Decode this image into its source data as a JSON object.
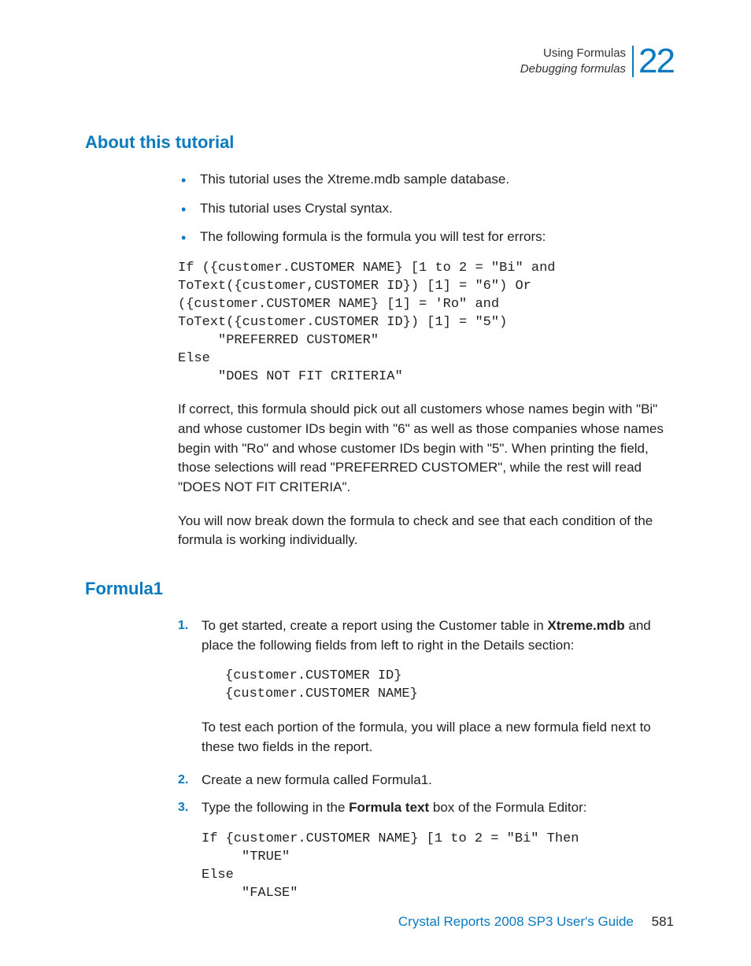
{
  "header": {
    "line1": "Using Formulas",
    "line2": "Debugging formulas",
    "chapter": "22"
  },
  "section1": {
    "title": "About this tutorial",
    "bullets": [
      "This tutorial uses the Xtreme.mdb sample database.",
      "This tutorial uses Crystal syntax.",
      "The following formula is the formula you will test for errors:"
    ],
    "code": "If ({customer.CUSTOMER NAME} [1 to 2 = \"Bi\" and\nToText({customer,CUSTOMER ID}) [1] = \"6\") Or\n({customer.CUSTOMER NAME} [1] = 'Ro\" and\nToText({customer.CUSTOMER ID}) [1] = \"5\")\n     \"PREFERRED CUSTOMER\"\nElse\n     \"DOES NOT FIT CRITERIA\"",
    "para1": "If correct, this formula should pick out all customers whose names begin with \"Bi\" and whose customer IDs begin with \"6\" as well as those companies whose names begin with \"Ro\" and whose customer IDs begin with \"5\". When printing the field, those selections will read \"PREFERRED CUSTOMER\", while the rest will read \"DOES NOT FIT CRITERIA\".",
    "para2": "You will now break down the formula to check and see that each condition of the formula is working individually."
  },
  "section2": {
    "title": "Formula1",
    "step1_pre": "To get started, create a report using the Customer table in ",
    "step1_bold": "Xtreme.mdb",
    "step1_post": " and place the following fields from left to right in the Details section:",
    "code1": "{customer.CUSTOMER ID}\n{customer.CUSTOMER NAME}",
    "para1": "To test each portion of the formula, you will place a new formula field next to these two fields in the report.",
    "step2": "Create a new formula called Formula1.",
    "step3_pre": "Type the following in the ",
    "step3_bold": "Formula text",
    "step3_post": " box of the Formula Editor:",
    "code2": "If {customer.CUSTOMER NAME} [1 to 2 = \"Bi\" Then\n     \"TRUE\"\nElse\n     \"FALSE\""
  },
  "footer": {
    "guide": "Crystal Reports 2008 SP3 User's Guide",
    "page": "581"
  }
}
